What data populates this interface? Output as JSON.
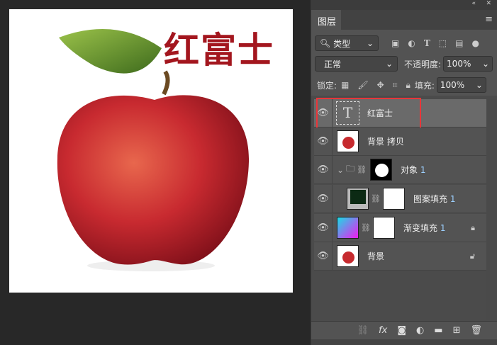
{
  "canvas": {
    "title_text": "红富士"
  },
  "panel": {
    "tab": "图层",
    "filter": {
      "label": "类型"
    },
    "blend_mode": "正常",
    "opacity_label": "不透明度:",
    "opacity": "100%",
    "lock_label": "锁定:",
    "fill_label": "填充:",
    "fill": "100%",
    "layers": [
      {
        "name": "红富士",
        "type": "text",
        "selected": true
      },
      {
        "name": "背景 拷贝",
        "type": "image"
      },
      {
        "name": "对象",
        "num": "1",
        "type": "group"
      },
      {
        "name": "图案填充",
        "num": "1",
        "type": "pattern"
      },
      {
        "name": "渐变填充",
        "num": "1",
        "type": "gradient",
        "locked": true
      },
      {
        "name": "背景",
        "type": "image",
        "locked": true
      }
    ]
  },
  "colors": {
    "title": "#a3161e",
    "highlight": "#e8363a"
  }
}
